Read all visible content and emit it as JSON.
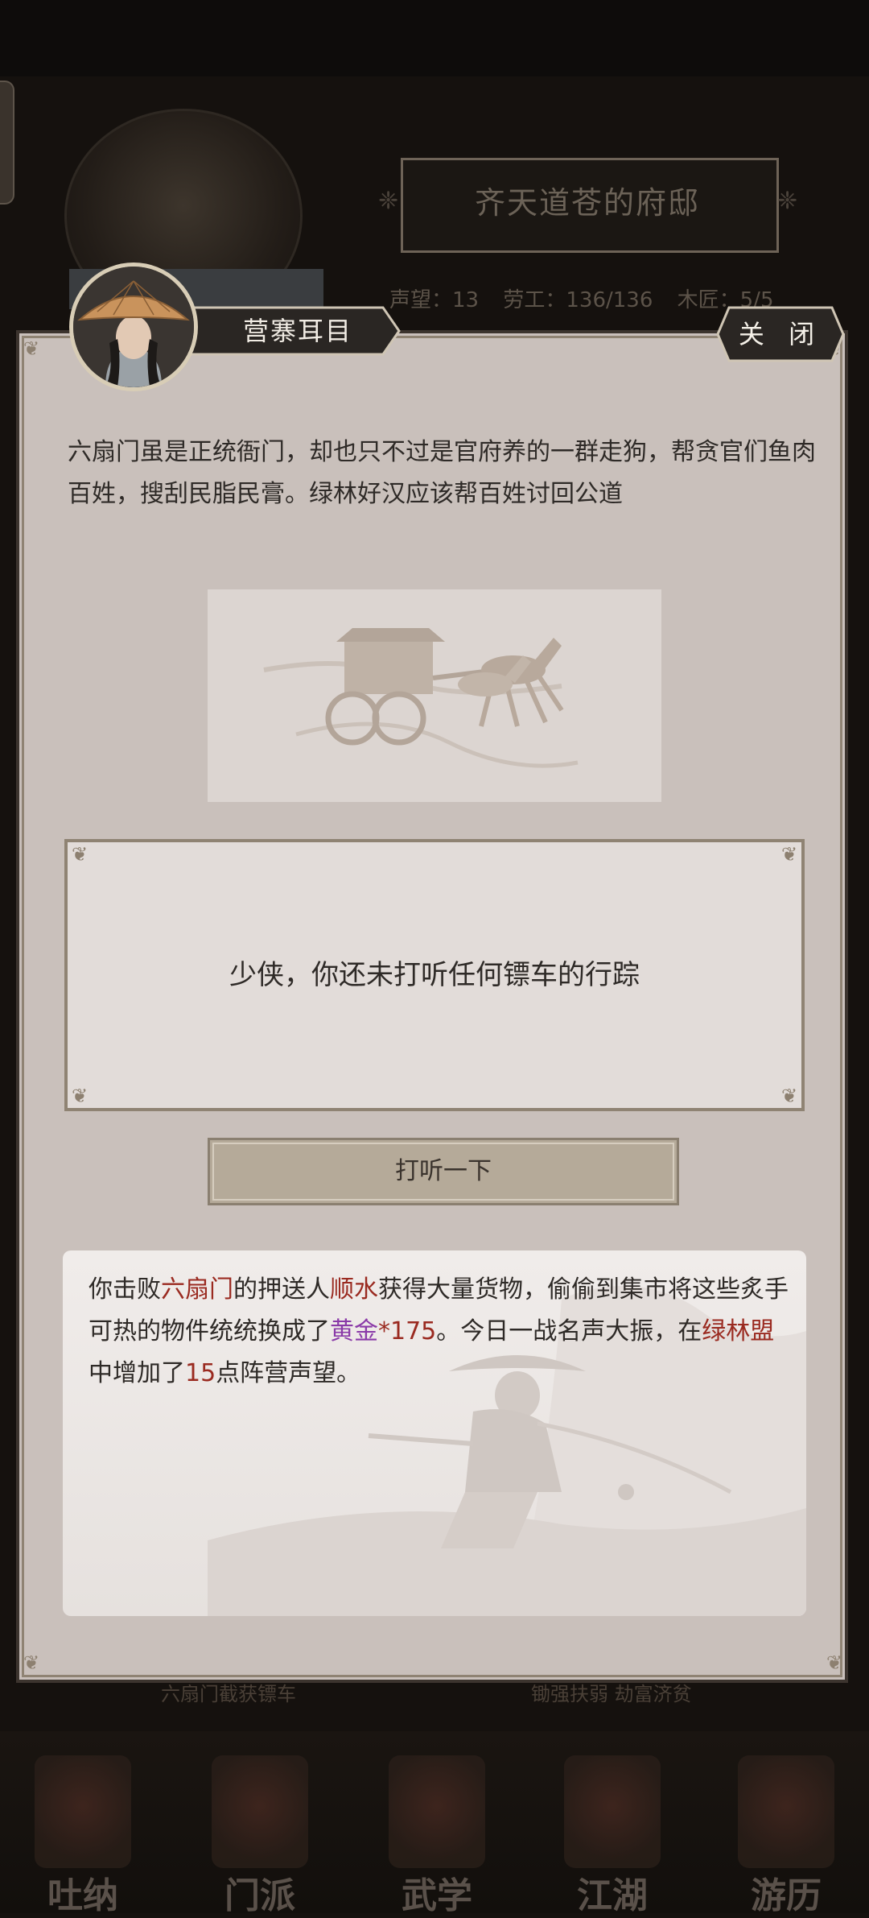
{
  "background": {
    "mansion_title": "齐天道苍的府邸",
    "stats": [
      "声望：13",
      "劳工：136/136",
      "木匠：5/5"
    ],
    "bottom_labels": [
      "六扇门截获镖车",
      "锄强扶弱 劫富济贫"
    ],
    "nav": [
      {
        "label": "吐纳",
        "icon": "meditation-icon"
      },
      {
        "label": "门派",
        "icon": "sect-banner-icon"
      },
      {
        "label": "武学",
        "icon": "martial-book-icon"
      },
      {
        "label": "江湖",
        "icon": "jianghu-icon"
      },
      {
        "label": "游历",
        "icon": "travel-icon"
      }
    ]
  },
  "dialog": {
    "title": "营寨耳目",
    "close_label": "关 闭",
    "description": "六扇门虽是正统衙门，却也只不过是官府养的一群走狗，帮贪官们鱼肉百姓，搜刮民脂民膏。绿林好汉应该帮百姓讨回公道",
    "status_text": "少侠，你还未打听任何镖车的行踪",
    "inquire_label": "打听一下",
    "log": {
      "p1": "你击败",
      "sect": "六扇门",
      "p2": "的押送人",
      "escort": "顺水",
      "p3": "获得大量货物，偷偷到集市将这些炙手可热的物件统统换成了",
      "item": "黄金",
      "p4": "*175",
      "p5": "。今日一战名声大振，在",
      "faction": "绿林盟",
      "p6": "中增加了",
      "points": "15",
      "p7": "点阵营声望。"
    }
  },
  "colors": {
    "highlight": "#9a2a20",
    "gold_item": "#8a3aa8",
    "panel_bg": "#c9c0bb"
  }
}
